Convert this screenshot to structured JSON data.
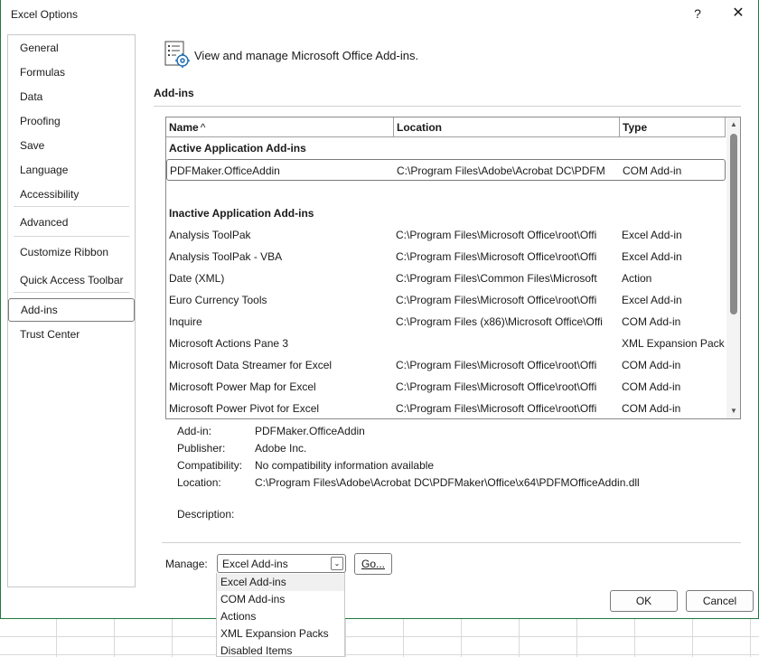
{
  "window": {
    "title": "Excel Options",
    "help_glyph": "?",
    "close_glyph": "✕"
  },
  "nav": {
    "items": [
      {
        "label": "General"
      },
      {
        "label": "Formulas"
      },
      {
        "label": "Data"
      },
      {
        "label": "Proofing"
      },
      {
        "label": "Save"
      },
      {
        "label": "Language"
      },
      {
        "label": "Accessibility"
      },
      {
        "label": "Advanced"
      },
      {
        "label": "Customize Ribbon"
      },
      {
        "label": "Quick Access Toolbar"
      },
      {
        "label": "Add-ins"
      },
      {
        "label": "Trust Center"
      }
    ],
    "selected": "Add-ins"
  },
  "header": {
    "icon": "addins-gear-icon",
    "text": "View and manage Microsoft Office Add-ins."
  },
  "section": {
    "title": "Add-ins"
  },
  "table": {
    "columns": [
      "Name",
      "Location",
      "Type"
    ],
    "sort_indicator": "^",
    "groups": {
      "active": "Active Application Add-ins",
      "inactive": "Inactive Application Add-ins"
    },
    "active_rows": [
      {
        "name": "PDFMaker.OfficeAddin",
        "location": "C:\\Program Files\\Adobe\\Acrobat DC\\PDFM",
        "type": "COM Add-in"
      }
    ],
    "inactive_rows": [
      {
        "name": "Analysis ToolPak",
        "location": "C:\\Program Files\\Microsoft Office\\root\\Offi",
        "type": "Excel Add-in"
      },
      {
        "name": "Analysis ToolPak - VBA",
        "location": "C:\\Program Files\\Microsoft Office\\root\\Offi",
        "type": "Excel Add-in"
      },
      {
        "name": "Date (XML)",
        "location": "C:\\Program Files\\Common Files\\Microsoft",
        "type": "Action"
      },
      {
        "name": "Euro Currency Tools",
        "location": "C:\\Program Files\\Microsoft Office\\root\\Offi",
        "type": "Excel Add-in"
      },
      {
        "name": "Inquire",
        "location": "C:\\Program Files (x86)\\Microsoft Office\\Offi",
        "type": "COM Add-in"
      },
      {
        "name": "Microsoft Actions Pane 3",
        "location": "",
        "type": "XML Expansion Pack"
      },
      {
        "name": "Microsoft Data Streamer for Excel",
        "location": "C:\\Program Files\\Microsoft Office\\root\\Offi",
        "type": "COM Add-in"
      },
      {
        "name": "Microsoft Power Map for Excel",
        "location": "C:\\Program Files\\Microsoft Office\\root\\Offi",
        "type": "COM Add-in"
      },
      {
        "name": "Microsoft Power Pivot for Excel",
        "location": "C:\\Program Files\\Microsoft Office\\root\\Offi",
        "type": "COM Add-in"
      }
    ]
  },
  "details": {
    "addin_label": "Add-in:",
    "addin_value": "PDFMaker.OfficeAddin",
    "publisher_label": "Publisher:",
    "publisher_value": "Adobe Inc.",
    "compat_label": "Compatibility:",
    "compat_value": "No compatibility information available",
    "location_label": "Location:",
    "location_value": "C:\\Program Files\\Adobe\\Acrobat DC\\PDFMaker\\Office\\x64\\PDFMOfficeAddin.dll",
    "description_label": "Description:"
  },
  "manage": {
    "label": "Manage:",
    "selected": "Excel Add-ins",
    "go_label": "Go...",
    "options": [
      "Excel Add-ins",
      "COM Add-ins",
      "Actions",
      "XML Expansion Packs",
      "Disabled Items"
    ]
  },
  "footer": {
    "ok_label": "OK",
    "cancel_label": "Cancel"
  }
}
